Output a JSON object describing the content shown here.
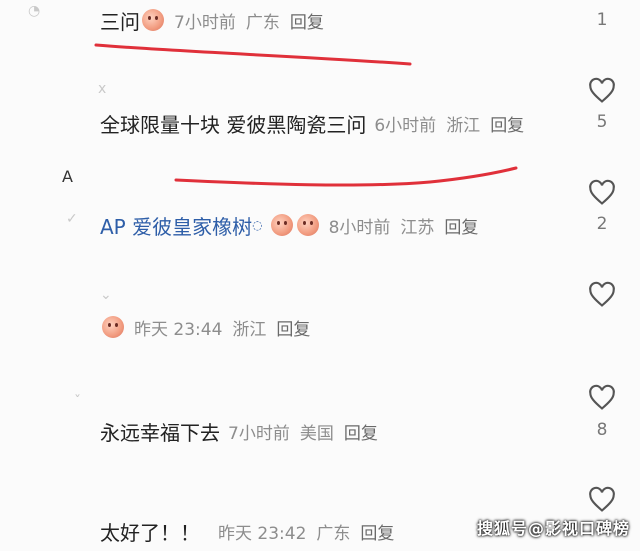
{
  "comments": [
    {
      "content": "三问",
      "time": "7小时前",
      "location": "广东",
      "reply": "回复",
      "likes": "1"
    },
    {
      "content": "全球限量十块 爱彼黑陶瓷三问",
      "time": "6小时前",
      "location": "浙江",
      "reply": "回复",
      "likes": "5"
    },
    {
      "content": "AP 爱彼皇家橡树",
      "time": "8小时前",
      "location": "江苏",
      "reply": "回复",
      "likes": "2"
    },
    {
      "content": "",
      "time": "昨天 23:44",
      "location": "浙江",
      "reply": "回复",
      "likes": ""
    },
    {
      "content": "永远幸福下去",
      "time": "7小时前",
      "location": "美国",
      "reply": "回复",
      "likes": "8"
    },
    {
      "content": "太好了！！",
      "time": "昨天 23:42",
      "location": "广东",
      "reply": "回复",
      "likes": ""
    }
  ],
  "watermark": "搜狐号@影视口碑榜",
  "colors": {
    "annotation_red": "#e0303a",
    "link_blue": "#2e5ea8",
    "heart_stroke": "#555555"
  },
  "icons": {
    "like": "heart-outline-icon",
    "sticker": "peach-face-emoji-icon"
  }
}
